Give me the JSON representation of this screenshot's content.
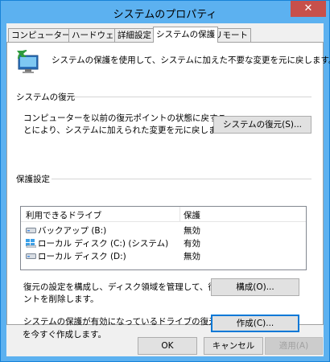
{
  "window": {
    "title": "システムのプロパティ",
    "close_glyph": "✕"
  },
  "tabs": [
    {
      "label": "コンピューター名"
    },
    {
      "label": "ハードウェア"
    },
    {
      "label": "詳細設定"
    },
    {
      "label": "システムの保護"
    },
    {
      "label": "リモート"
    }
  ],
  "intro": {
    "text": "システムの保護を使用して、システムに加えた不要な変更を元に戻します。"
  },
  "restore": {
    "heading": "システムの復元",
    "desc_line1": "コンピューターを以前の復元ポイントの状態に戻すこ",
    "desc_line2": "とにより、システムに加えられた変更を元に戻します。",
    "button": "システムの復元(S)..."
  },
  "protection": {
    "heading": "保護設定",
    "columns": {
      "drive": "利用できるドライブ",
      "status": "保護"
    },
    "drives": [
      {
        "name": "バックアップ (B:)",
        "status": "無効",
        "icon": "drive-icon"
      },
      {
        "name": "ローカル ディスク (C:) (システム)",
        "status": "有効",
        "icon": "system-drive-icon"
      },
      {
        "name": "ローカル ディスク (D:)",
        "status": "無効",
        "icon": "drive-icon"
      }
    ],
    "configure_line1": "復元の設定を構成し、ディスク領域を管理して、復元ポイ",
    "configure_line2": "ントを削除します。",
    "configure_button": "構成(O)...",
    "create_line1": "システムの保護が有効になっているドライブの復元ポイント",
    "create_line2": "を今すぐ作成します。",
    "create_button": "作成(C)..."
  },
  "footer": {
    "ok": "OK",
    "cancel": "キャンセル",
    "apply": "適用(A)"
  },
  "colors": {
    "title_bar": "#5cb1f0",
    "close": "#c7504b",
    "focus": "#0078d7"
  }
}
